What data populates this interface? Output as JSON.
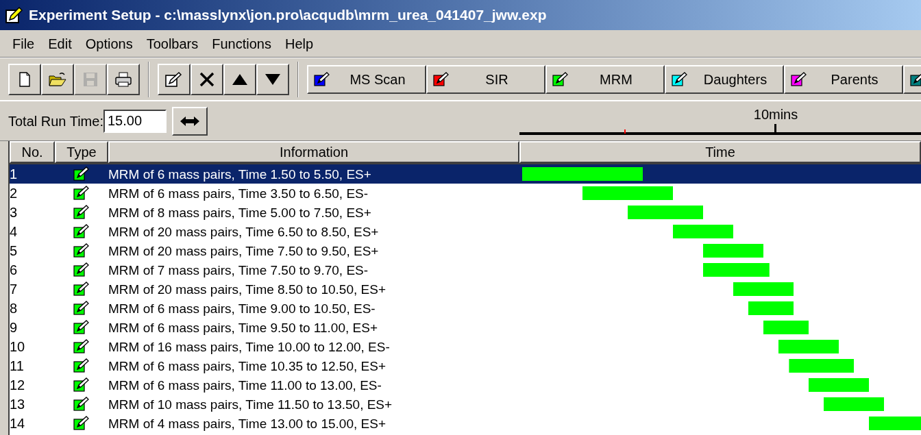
{
  "window": {
    "title": "Experiment Setup - c:\\masslynx\\jon.pro\\acqudb\\mrm_urea_041407_jww.exp"
  },
  "menu": [
    "File",
    "Edit",
    "Options",
    "Toolbars",
    "Functions",
    "Help"
  ],
  "toolbar": {
    "file_tools": [
      {
        "kind": "new",
        "disabled": false
      },
      {
        "kind": "open",
        "disabled": false
      },
      {
        "kind": "save",
        "disabled": true
      },
      {
        "kind": "print",
        "disabled": false
      }
    ],
    "edit_tools": [
      {
        "kind": "edit"
      },
      {
        "kind": "delete"
      },
      {
        "kind": "up"
      },
      {
        "kind": "down"
      }
    ],
    "functions": [
      {
        "label": "MS Scan",
        "color": "#0000ff"
      },
      {
        "label": "SIR",
        "color": "#ff0000"
      },
      {
        "label": "MRM",
        "color": "#00ff00"
      },
      {
        "label": "Daughters",
        "color": "#00ffff"
      },
      {
        "label": "Parents",
        "color": "#ff00ff"
      },
      {
        "color": "#008080"
      }
    ]
  },
  "run_time": {
    "label": "Total Run Time:",
    "value": "15.00"
  },
  "timeline": {
    "ruler_label": "10mins"
  },
  "table": {
    "columns": [
      "No.",
      "Type",
      "Information",
      "Time"
    ],
    "rows": [
      {
        "no": "1",
        "info": "MRM of 6 mass pairs, Time 1.50 to 5.50, ES+",
        "selected": true
      },
      {
        "no": "2",
        "info": "MRM of 6 mass pairs, Time 3.50 to 6.50, ES-",
        "selected": false
      },
      {
        "no": "3",
        "info": "MRM of 8 mass pairs, Time 5.00 to 7.50, ES+",
        "selected": false
      },
      {
        "no": "4",
        "info": "MRM of 20 mass pairs, Time 6.50 to 8.50, ES+",
        "selected": false
      },
      {
        "no": "5",
        "info": "MRM of 20 mass pairs, Time 7.50 to 9.50, ES+",
        "selected": false
      },
      {
        "no": "6",
        "info": "MRM of 7 mass pairs, Time 7.50 to 9.70, ES-",
        "selected": false
      },
      {
        "no": "7",
        "info": "MRM of 20 mass pairs, Time 8.50 to 10.50, ES+",
        "selected": false
      },
      {
        "no": "8",
        "info": "MRM of 6 mass pairs, Time 9.00 to 10.50, ES-",
        "selected": false
      },
      {
        "no": "9",
        "info": "MRM of 6 mass pairs, Time 9.50 to 11.00, ES+",
        "selected": false
      },
      {
        "no": "10",
        "info": "MRM of 16 mass pairs, Time 10.00 to 12.00, ES-",
        "selected": false
      },
      {
        "no": "11",
        "info": "MRM of 6 mass pairs, Time 10.35 to 12.50, ES+",
        "selected": false
      },
      {
        "no": "12",
        "info": "MRM of 6 mass pairs, Time 11.00 to 13.00, ES-",
        "selected": false
      },
      {
        "no": "13",
        "info": "MRM of 10 mass pairs, Time 11.50 to 13.50, ES+",
        "selected": false
      },
      {
        "no": "14",
        "info": "MRM of 4 mass pairs, Time 13.00 to 15.00, ES+",
        "selected": false
      }
    ]
  }
}
